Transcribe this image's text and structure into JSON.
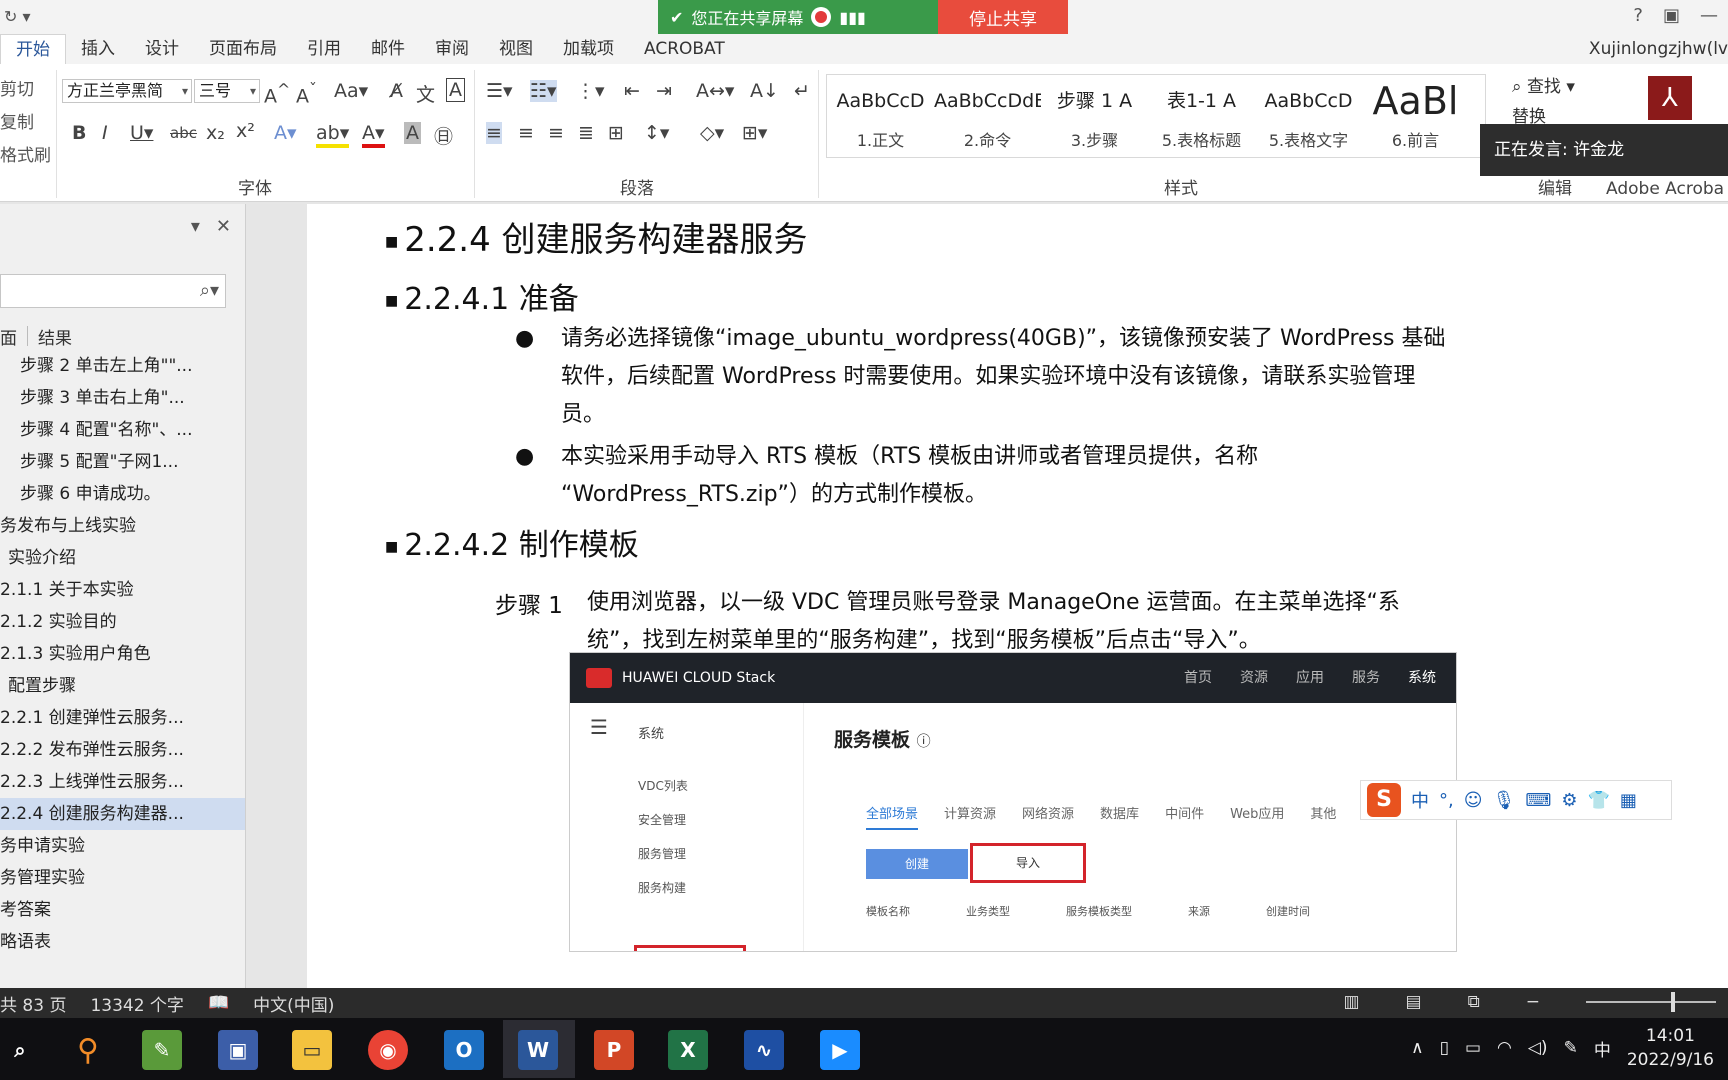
{
  "share_banner": {
    "message": "您正在共享屏幕",
    "stop_label": "停止共享"
  },
  "tabs": [
    "开始",
    "插入",
    "设计",
    "页面布局",
    "引用",
    "邮件",
    "审阅",
    "视图",
    "加载项",
    "ACROBAT"
  ],
  "active_tab": "开始",
  "user_name": "Xujinlongzjhw(lv",
  "clipboard": {
    "cut": "剪切",
    "copy": "复制",
    "format_painter": "格式刷"
  },
  "font": {
    "name": "方正兰亭黑简",
    "size": "三号",
    "group_label": "字体"
  },
  "paragraph": {
    "group_label": "段落"
  },
  "styles": {
    "group_label": "样式",
    "items": [
      {
        "sample": "AaBbCcD",
        "name": "1.正文"
      },
      {
        "sample": "AaBbCcDdE",
        "name": "2.命令"
      },
      {
        "sample": "步骤 1  A",
        "name": "3.步骤"
      },
      {
        "sample": "表1-1  A",
        "name": "5.表格标题"
      },
      {
        "sample": "AaBbCcD",
        "name": "5.表格文字"
      },
      {
        "sample": "AaBl",
        "name": "6.前言"
      }
    ]
  },
  "editing": {
    "find": "查找",
    "replace": "替换",
    "group_label": "编辑"
  },
  "acrobat_label": "Adobe Acroba",
  "speaker": "正在发言: 许金龙",
  "nav": {
    "tab_pages": "面",
    "tab_results": "结果",
    "items": [
      {
        "label": "步骤 2 单击左上角\"\"...",
        "indent": 20
      },
      {
        "label": "步骤 3 单击右上角\"...",
        "indent": 20
      },
      {
        "label": "步骤 4 配置\"名称\"、...",
        "indent": 20
      },
      {
        "label": "步骤 5 配置\"子网1...",
        "indent": 20
      },
      {
        "label": "步骤 6 申请成功。",
        "indent": 20
      },
      {
        "label": "务发布与上线实验",
        "indent": 0
      },
      {
        "label": "实验介绍",
        "indent": 8
      },
      {
        "label": "2.1.1  关于本实验",
        "indent": 0
      },
      {
        "label": "2.1.2  实验目的",
        "indent": 0
      },
      {
        "label": "2.1.3  实验用户角色",
        "indent": 0
      },
      {
        "label": "配置步骤",
        "indent": 8
      },
      {
        "label": "2.2.1  创建弹性云服务...",
        "indent": 0
      },
      {
        "label": "2.2.2  发布弹性云服务...",
        "indent": 0
      },
      {
        "label": "2.2.3  上线弹性云服务...",
        "indent": 0
      },
      {
        "label": "2.2.4  创建服务构建器...",
        "indent": 0,
        "selected": true
      },
      {
        "label": "务申请实验",
        "indent": 0
      },
      {
        "label": "务管理实验",
        "indent": 0
      },
      {
        "label": "考答案",
        "indent": 0
      },
      {
        "label": "略语表",
        "indent": 0
      }
    ]
  },
  "document": {
    "h1": "2.2.4 创建服务构建器服务",
    "h2a": "2.2.4.1 准备",
    "bullet1_line1": "请务必选择镜像“image_ubuntu_wordpress(40GB)”，该镜像预安装了 WordPress 基础",
    "bullet1_line2": "软件，后续配置 WordPress 时需要使用。如果实验环境中没有该镜像，请联系实验管理",
    "bullet1_line3": "员。",
    "bullet2_line1": "本实验采用手动导入 RTS 模板（RTS 模板由讲师或者管理员提供，名称",
    "bullet2_line2": "“WordPress_RTS.zip”）的方式制作模板。",
    "h2b": "2.2.4.2 制作模板",
    "step_label": "步骤 1",
    "step_line1": "使用浏览器，以一级 VDC 管理员账号登录 ManageOne 运营面。在主菜单选择“系",
    "step_line2": "统”，找到左树菜单里的“服务构建”，找到“服务模板”后点击“导入”。"
  },
  "screenshot": {
    "brand": "HUAWEI CLOUD Stack",
    "menu": [
      "首页",
      "资源",
      "应用",
      "服务",
      "系统"
    ],
    "side_title": "系统",
    "side_items": [
      "VDC列表",
      "安全管理",
      "服务管理",
      "服务构建"
    ],
    "title": "服务模板",
    "filters": [
      "全部场景",
      "计算资源",
      "网络资源",
      "数据库",
      "中间件",
      "Web应用",
      "其他"
    ],
    "create": "创建",
    "import": "导入",
    "columns": [
      "模板名称",
      "业务类型",
      "服务模板类型",
      "来源",
      "创建时间"
    ]
  },
  "ime": {
    "logo": "S",
    "mode": "中"
  },
  "status": {
    "pages": "共 83 页",
    "words": "13342 个字",
    "lang": "中文(中国)",
    "zoom": 0.65
  },
  "taskbar": {
    "time": "14:01",
    "date": "2022/9/16",
    "ime": "中"
  }
}
